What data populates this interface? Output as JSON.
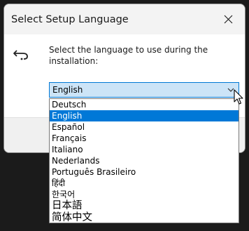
{
  "window": {
    "title": "Select Setup Language"
  },
  "instruction": "Select the language to use during the installation:",
  "combo": {
    "selected": "English"
  },
  "languages": [
    "Deutsch",
    "English",
    "Español",
    "Français",
    "Italiano",
    "Nederlands",
    "Português Brasileiro",
    "हिंदी",
    "한국어",
    "日本語",
    "简体中文"
  ],
  "selected_index": 1,
  "colors": {
    "selection": "#0078d7",
    "combo_background": "#cce4f7",
    "combo_border": "#0078d4"
  },
  "icons": {
    "back": "back-arrow-icon",
    "close": "close-icon",
    "dropdown": "chevron-down-icon",
    "cursor": "mouse-pointer-icon"
  }
}
